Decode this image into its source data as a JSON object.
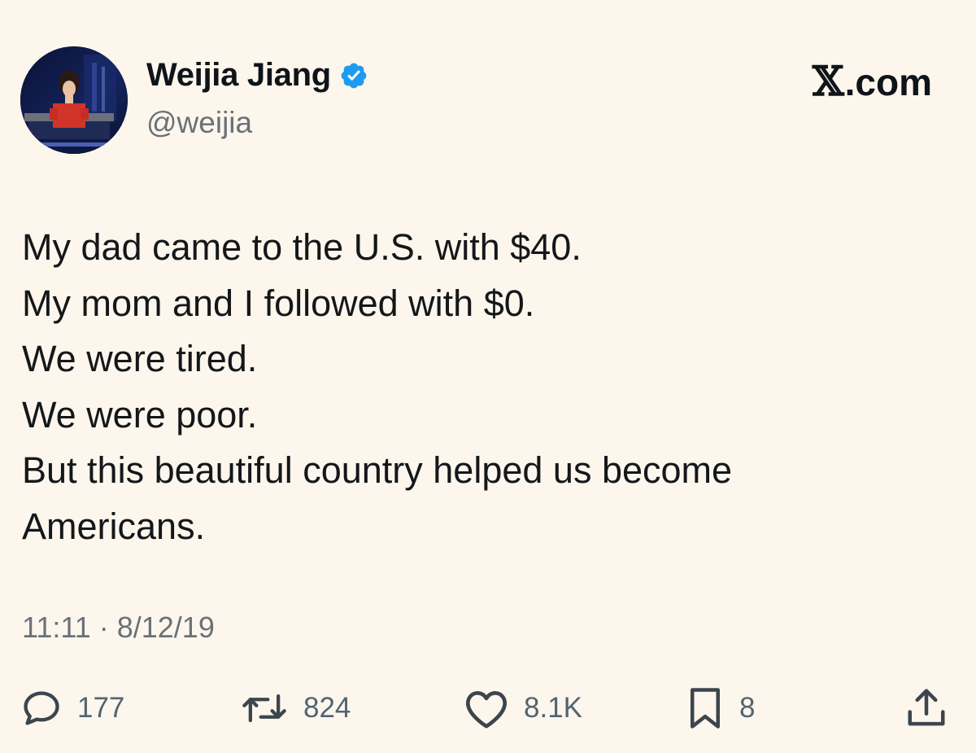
{
  "author": {
    "display_name": "Weijia Jiang",
    "handle": "@weijia",
    "verified_icon": "verified-badge-icon",
    "badge_color": "#1d9bf0"
  },
  "brand": {
    "symbol": "𝕏",
    "suffix": ".com"
  },
  "tweet": {
    "lines": [
      "My dad came to the U.S. with $40.",
      "My mom and I followed with $0.",
      "We were tired.",
      "We were poor.",
      "But this beautiful country helped us become",
      "Americans."
    ],
    "timestamp": "11:11 · 8/12/19"
  },
  "actions": {
    "reply": {
      "icon": "reply-icon",
      "count": "177"
    },
    "retweet": {
      "icon": "retweet-icon",
      "count": "824"
    },
    "like": {
      "icon": "heart-icon",
      "count": "8.1K"
    },
    "bookmark": {
      "icon": "bookmark-icon",
      "count": "8"
    },
    "share": {
      "icon": "share-icon"
    }
  },
  "colors": {
    "background": "#fcf6ec",
    "text": "#14171a",
    "muted": "#6b7177",
    "icon": "#536471"
  }
}
